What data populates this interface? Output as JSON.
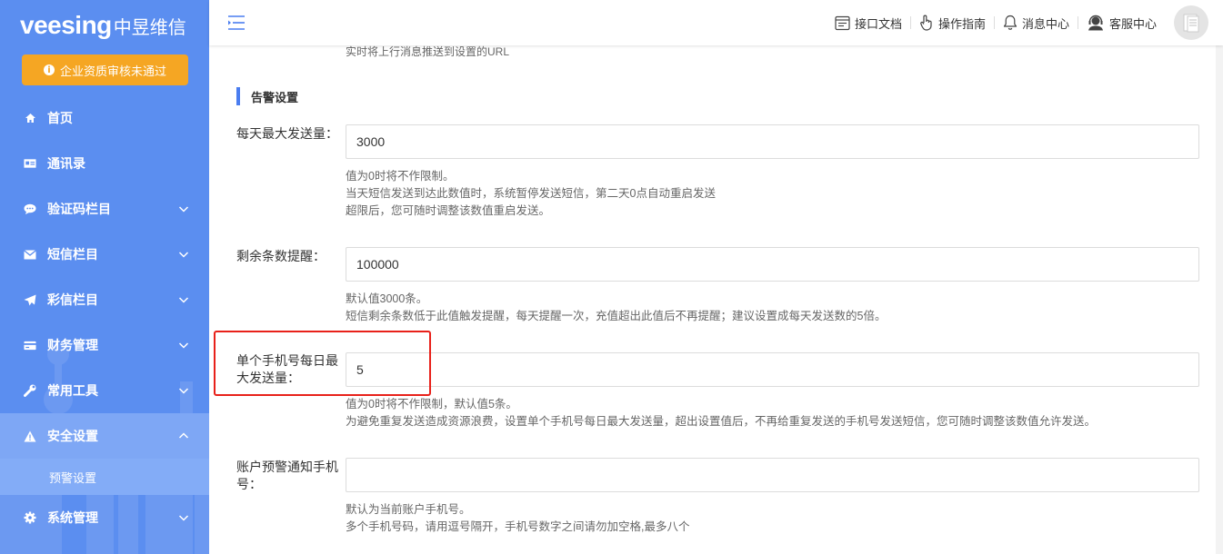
{
  "brand": {
    "en": "veesing",
    "cn": "中昱维信"
  },
  "alert_button": "企业资质审核未通过",
  "nav": [
    {
      "label": "首页",
      "icon": "home-icon",
      "expandable": false
    },
    {
      "label": "通讯录",
      "icon": "contacts-icon",
      "expandable": false
    },
    {
      "label": "验证码栏目",
      "icon": "chat-icon",
      "expandable": true
    },
    {
      "label": "短信栏目",
      "icon": "envelope-icon",
      "expandable": true
    },
    {
      "label": "彩信栏目",
      "icon": "send-icon",
      "expandable": true
    },
    {
      "label": "财务管理",
      "icon": "credit-card-icon",
      "expandable": true
    },
    {
      "label": "常用工具",
      "icon": "wrench-icon",
      "expandable": true
    },
    {
      "label": "安全设置",
      "icon": "warning-icon",
      "expandable": true,
      "expanded": true
    },
    {
      "label": "系统管理",
      "icon": "gear-icon",
      "expandable": true
    }
  ],
  "sub_nav": {
    "label": "预警设置"
  },
  "topbar": {
    "links": [
      {
        "label": "接口文档",
        "icon": "api-doc-icon"
      },
      {
        "label": "操作指南",
        "icon": "hand-pointer-icon"
      },
      {
        "label": "消息中心",
        "icon": "bell-icon"
      },
      {
        "label": "客服中心",
        "icon": "headset-icon"
      }
    ]
  },
  "content": {
    "cut_text": "实时将上行消息推送到设置的URL",
    "section_title": "告警设置",
    "fields": [
      {
        "label": "每天最大发送量：",
        "value": "3000",
        "help": [
          "值为0时将不作限制。",
          "当天短信发送到达此数值时，系统暂停发送短信，第二天0点自动重启发送",
          "超限后，您可随时调整该数值重启发送。"
        ]
      },
      {
        "label": "剩余条数提醒：",
        "value": "100000",
        "help": [
          "默认值3000条。",
          "短信剩余条数低于此值触发提醒，每天提醒一次，充值超出此值后不再提醒；建议设置成每天发送数的5倍。"
        ]
      },
      {
        "label": "单个手机号每日最大发送量：",
        "value": "5",
        "help": [
          "值为0时将不作限制，默认值5条。",
          "为避免重复发送造成资源浪费，设置单个手机号每日最大发送量，超出设置值后，不再给重复发送的手机号发送短信，您可随时调整该数值允许发送。"
        ]
      },
      {
        "label": "账户预警通知手机号：",
        "value": "",
        "help": [
          "默认为当前账户手机号。",
          "多个手机号码，请用逗号隔开，手机号数字之间请勿加空格,最多八个"
        ]
      }
    ]
  },
  "colors": {
    "sidebar": "#5b8ef0",
    "alert": "#f5a623",
    "accent": "#4a7df0",
    "highlight": "#e8211a"
  }
}
